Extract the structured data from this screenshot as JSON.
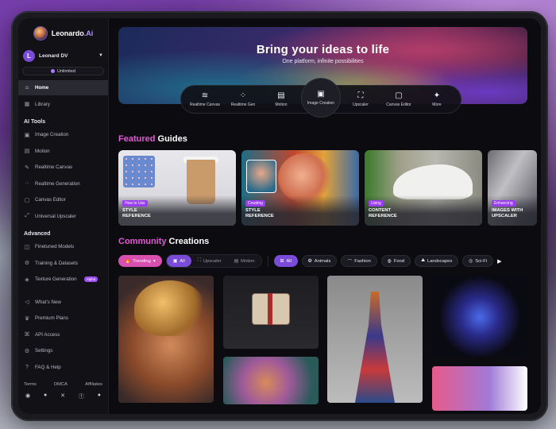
{
  "app": {
    "logo_text": "Leonardo",
    "logo_suffix": ".Ai"
  },
  "user": {
    "initial": "L",
    "name": "Leonard DV",
    "plan": "Unlimited"
  },
  "nav": {
    "home": "Home",
    "library": "Library",
    "tools_heading": "AI Tools",
    "tools": [
      "Image Creation",
      "Motion",
      "Realtime Canvas",
      "Realtime Generation",
      "Canvas Editor",
      "Universal Upscaler"
    ],
    "advanced_heading": "Advanced",
    "advanced": [
      "Finetuned Models",
      "Training & Datasets",
      "Texture Generation"
    ],
    "alpha_badge": "Alpha",
    "bottom": [
      "What's New",
      "Premium Plans",
      "API Access",
      "Settings",
      "FAQ & Help"
    ]
  },
  "footer_links": [
    "Terms",
    "DMCA",
    "Affiliates"
  ],
  "hero": {
    "title": "Bring your ideas to life",
    "subtitle": "One platform, infinite possibilities"
  },
  "toolbar": [
    "Realtime Canvas",
    "Realtime Gen",
    "Motion",
    "Image Creation",
    "Upscaler",
    "Canvas Editor",
    "More"
  ],
  "featured": {
    "heading_accent": "Featured",
    "heading_rest": " Guides",
    "cards": [
      {
        "tag": "How to Use",
        "line1": "STYLE",
        "line2": "REFERENCE"
      },
      {
        "tag": "Creating",
        "line1": "STYLE",
        "line2": "REFERENCE"
      },
      {
        "tag": "Using",
        "line1": "CONTENT",
        "line2": "REFERENCE"
      },
      {
        "tag": "Enhancing",
        "line1": "IMAGES WITH",
        "line2": "UPSCALER"
      }
    ]
  },
  "community": {
    "heading_accent": "Community",
    "heading_rest": " Creations",
    "sort": "Trending",
    "type_filters": [
      "All",
      "Upscaler",
      "Motion"
    ],
    "category_filters": [
      "All",
      "Animals",
      "Fashion",
      "Food",
      "Landscapes",
      "Sci-Fi"
    ]
  },
  "colors": {
    "accent_pink": "#e15bd4",
    "accent_purple": "#7a4bd8"
  }
}
